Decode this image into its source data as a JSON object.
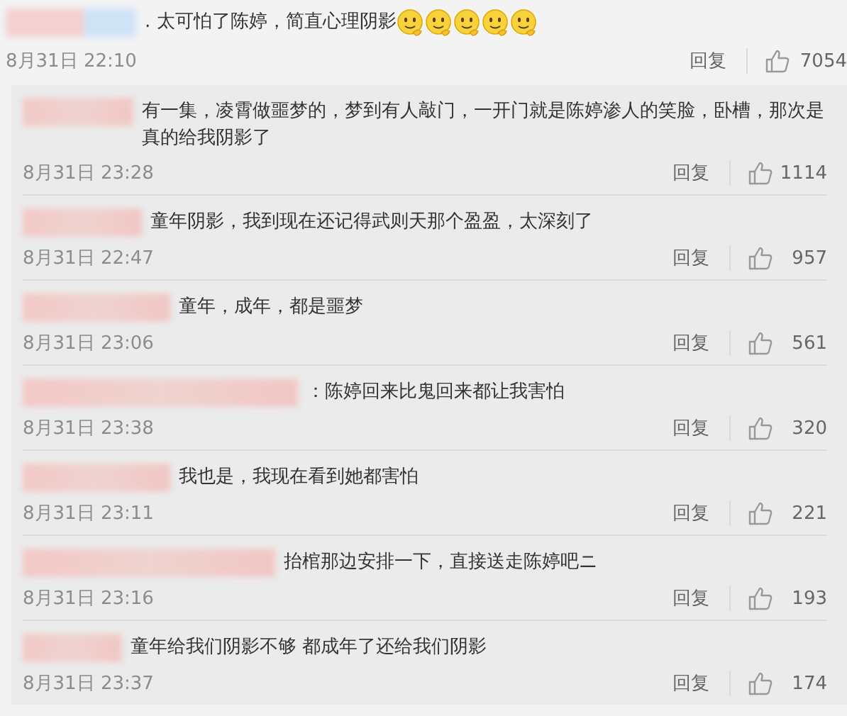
{
  "comment": {
    "text": ". 太可怕了陈婷，简直心理阴影",
    "emojis": [
      {
        "kind": "smile"
      },
      {
        "kind": "smile"
      },
      {
        "kind": "smile"
      },
      {
        "kind": "smile"
      },
      {
        "kind": "smile"
      }
    ],
    "time": "8月31日 22:10",
    "reply_label": "回复",
    "likes": "7054"
  },
  "replies": [
    {
      "text": "有一集，凌霄做噩梦的，梦到有人敲门，一开门就是陈婷渗人的笑脸，卧槽，那次是真的给我阴影了",
      "time": "8月31日 23:28",
      "reply_label": "回复",
      "likes": "1114"
    },
    {
      "text": "童年阴影，我到现在还记得武则天那个盈盈，太深刻了",
      "time": "8月31日 22:47",
      "reply_label": "回复",
      "likes": "957"
    },
    {
      "text": "童年，成年，都是噩梦",
      "time": "8月31日 23:06",
      "reply_label": "回复",
      "likes": "561"
    },
    {
      "text": "：陈婷回来比鬼回来都让我害怕",
      "time": "8月31日 23:38",
      "reply_label": "回复",
      "likes": "320"
    },
    {
      "text": "我也是，我现在看到她都害怕",
      "time": "8月31日 23:11",
      "reply_label": "回复",
      "likes": "221"
    },
    {
      "text": "抬棺那边安排一下，直接送走陈婷吧ニ",
      "time": "8月31日 23:16",
      "reply_label": "回复",
      "likes": "193"
    },
    {
      "text": "童年给我们阴影不够  都成年了还给我们阴影",
      "time": "8月31日 23:37",
      "reply_label": "回复",
      "likes": "174"
    }
  ]
}
